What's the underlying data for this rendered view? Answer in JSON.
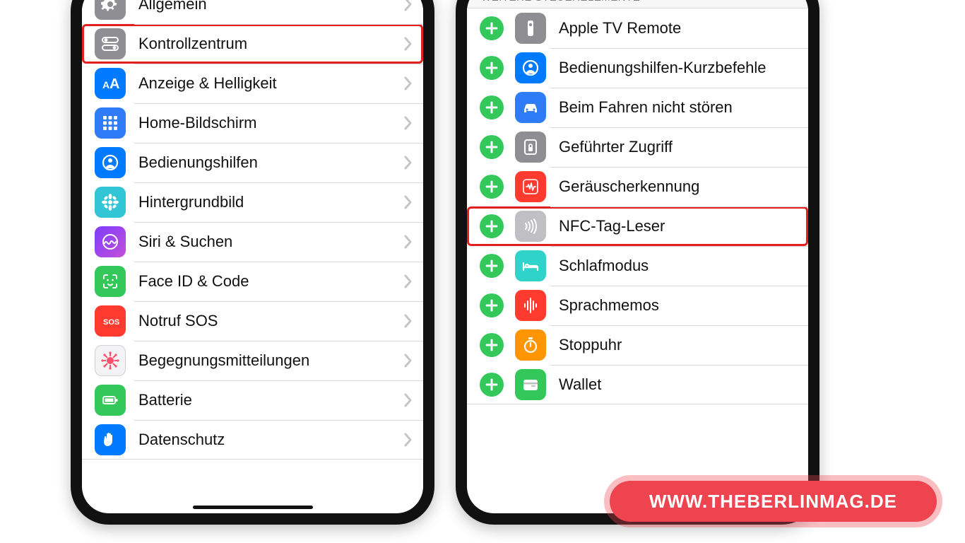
{
  "watermark": "WWW.THEBERLINMAG.DE",
  "left": {
    "items": [
      {
        "label": "Allgemein",
        "icon": "gear-icon",
        "color": "ic-gray",
        "highlight": false
      },
      {
        "label": "Kontrollzentrum",
        "icon": "switches-icon",
        "color": "ic-gray",
        "highlight": true
      },
      {
        "label": "Anzeige & Helligkeit",
        "icon": "textsize-icon",
        "color": "ic-blue",
        "highlight": false
      },
      {
        "label": "Home-Bildschirm",
        "icon": "grid-icon",
        "color": "ic-blue2",
        "highlight": false
      },
      {
        "label": "Bedienungshilfen",
        "icon": "person-icon",
        "color": "ic-blue",
        "highlight": false
      },
      {
        "label": "Hintergrundbild",
        "icon": "flower-icon",
        "color": "ic-cyan",
        "highlight": false
      },
      {
        "label": "Siri & Suchen",
        "icon": "siri-icon",
        "color": "ic-indigo",
        "highlight": false
      },
      {
        "label": "Face ID & Code",
        "icon": "faceid-icon",
        "color": "ic-green",
        "highlight": false
      },
      {
        "label": "Notruf SOS",
        "icon": "sos-icon",
        "color": "ic-red",
        "highlight": false
      },
      {
        "label": "Begegnungsmitteilungen",
        "icon": "virus-icon",
        "color": "ic-white",
        "highlight": false
      },
      {
        "label": "Batterie",
        "icon": "battery-icon",
        "color": "ic-green",
        "highlight": false
      },
      {
        "label": "Datenschutz",
        "icon": "hand-icon",
        "color": "ic-blue",
        "highlight": false
      }
    ]
  },
  "right": {
    "section": "WEITERE STEUERELEMENTE",
    "items": [
      {
        "label": "Apple TV Remote",
        "icon": "remote-icon",
        "color": "ic-gray",
        "highlight": false
      },
      {
        "label": "Bedienungshilfen-Kurzbefehle",
        "icon": "person-icon",
        "color": "ic-blue",
        "highlight": false
      },
      {
        "label": "Beim Fahren nicht stören",
        "icon": "car-icon",
        "color": "ic-blue2",
        "highlight": false
      },
      {
        "label": "Geführter Zugriff",
        "icon": "lock-icon",
        "color": "ic-gray",
        "highlight": false
      },
      {
        "label": "Geräuscherkennung",
        "icon": "sound-icon",
        "color": "ic-red",
        "highlight": false
      },
      {
        "label": "NFC-Tag-Leser",
        "icon": "nfc-icon",
        "color": "ic-lgray",
        "highlight": true
      },
      {
        "label": "Schlafmodus",
        "icon": "bed-icon",
        "color": "ic-teal",
        "highlight": false
      },
      {
        "label": "Sprachmemos",
        "icon": "waveform-icon",
        "color": "ic-red",
        "highlight": false
      },
      {
        "label": "Stoppuhr",
        "icon": "stopwatch-icon",
        "color": "ic-orange",
        "highlight": false
      },
      {
        "label": "Wallet",
        "icon": "wallet-icon",
        "color": "ic-green",
        "highlight": false
      }
    ]
  }
}
